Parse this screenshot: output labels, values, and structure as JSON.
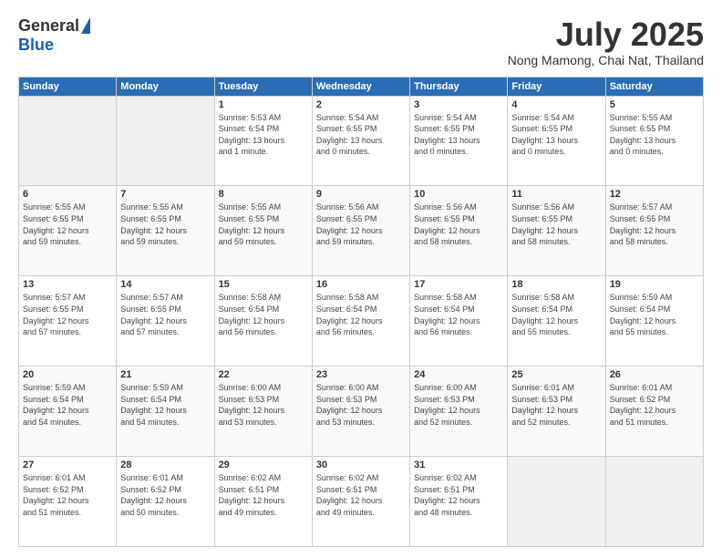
{
  "logo": {
    "general": "General",
    "blue": "Blue"
  },
  "header": {
    "title": "July 2025",
    "subtitle": "Nong Mamong, Chai Nat, Thailand"
  },
  "weekdays": [
    "Sunday",
    "Monday",
    "Tuesday",
    "Wednesday",
    "Thursday",
    "Friday",
    "Saturday"
  ],
  "weeks": [
    [
      {
        "day": "",
        "info": ""
      },
      {
        "day": "",
        "info": ""
      },
      {
        "day": "1",
        "info": "Sunrise: 5:53 AM\nSunset: 6:54 PM\nDaylight: 13 hours\nand 1 minute."
      },
      {
        "day": "2",
        "info": "Sunrise: 5:54 AM\nSunset: 6:55 PM\nDaylight: 13 hours\nand 0 minutes."
      },
      {
        "day": "3",
        "info": "Sunrise: 5:54 AM\nSunset: 6:55 PM\nDaylight: 13 hours\nand 0 minutes."
      },
      {
        "day": "4",
        "info": "Sunrise: 5:54 AM\nSunset: 6:55 PM\nDaylight: 13 hours\nand 0 minutes."
      },
      {
        "day": "5",
        "info": "Sunrise: 5:55 AM\nSunset: 6:55 PM\nDaylight: 13 hours\nand 0 minutes."
      }
    ],
    [
      {
        "day": "6",
        "info": "Sunrise: 5:55 AM\nSunset: 6:55 PM\nDaylight: 12 hours\nand 59 minutes."
      },
      {
        "day": "7",
        "info": "Sunrise: 5:55 AM\nSunset: 6:55 PM\nDaylight: 12 hours\nand 59 minutes."
      },
      {
        "day": "8",
        "info": "Sunrise: 5:55 AM\nSunset: 6:55 PM\nDaylight: 12 hours\nand 59 minutes."
      },
      {
        "day": "9",
        "info": "Sunrise: 5:56 AM\nSunset: 6:55 PM\nDaylight: 12 hours\nand 59 minutes."
      },
      {
        "day": "10",
        "info": "Sunrise: 5:56 AM\nSunset: 6:55 PM\nDaylight: 12 hours\nand 58 minutes."
      },
      {
        "day": "11",
        "info": "Sunrise: 5:56 AM\nSunset: 6:55 PM\nDaylight: 12 hours\nand 58 minutes."
      },
      {
        "day": "12",
        "info": "Sunrise: 5:57 AM\nSunset: 6:55 PM\nDaylight: 12 hours\nand 58 minutes."
      }
    ],
    [
      {
        "day": "13",
        "info": "Sunrise: 5:57 AM\nSunset: 6:55 PM\nDaylight: 12 hours\nand 57 minutes."
      },
      {
        "day": "14",
        "info": "Sunrise: 5:57 AM\nSunset: 6:55 PM\nDaylight: 12 hours\nand 57 minutes."
      },
      {
        "day": "15",
        "info": "Sunrise: 5:58 AM\nSunset: 6:54 PM\nDaylight: 12 hours\nand 56 minutes."
      },
      {
        "day": "16",
        "info": "Sunrise: 5:58 AM\nSunset: 6:54 PM\nDaylight: 12 hours\nand 56 minutes."
      },
      {
        "day": "17",
        "info": "Sunrise: 5:58 AM\nSunset: 6:54 PM\nDaylight: 12 hours\nand 56 minutes."
      },
      {
        "day": "18",
        "info": "Sunrise: 5:58 AM\nSunset: 6:54 PM\nDaylight: 12 hours\nand 55 minutes."
      },
      {
        "day": "19",
        "info": "Sunrise: 5:59 AM\nSunset: 6:54 PM\nDaylight: 12 hours\nand 55 minutes."
      }
    ],
    [
      {
        "day": "20",
        "info": "Sunrise: 5:59 AM\nSunset: 6:54 PM\nDaylight: 12 hours\nand 54 minutes."
      },
      {
        "day": "21",
        "info": "Sunrise: 5:59 AM\nSunset: 6:54 PM\nDaylight: 12 hours\nand 54 minutes."
      },
      {
        "day": "22",
        "info": "Sunrise: 6:00 AM\nSunset: 6:53 PM\nDaylight: 12 hours\nand 53 minutes."
      },
      {
        "day": "23",
        "info": "Sunrise: 6:00 AM\nSunset: 6:53 PM\nDaylight: 12 hours\nand 53 minutes."
      },
      {
        "day": "24",
        "info": "Sunrise: 6:00 AM\nSunset: 6:53 PM\nDaylight: 12 hours\nand 52 minutes."
      },
      {
        "day": "25",
        "info": "Sunrise: 6:01 AM\nSunset: 6:53 PM\nDaylight: 12 hours\nand 52 minutes."
      },
      {
        "day": "26",
        "info": "Sunrise: 6:01 AM\nSunset: 6:52 PM\nDaylight: 12 hours\nand 51 minutes."
      }
    ],
    [
      {
        "day": "27",
        "info": "Sunrise: 6:01 AM\nSunset: 6:52 PM\nDaylight: 12 hours\nand 51 minutes."
      },
      {
        "day": "28",
        "info": "Sunrise: 6:01 AM\nSunset: 6:52 PM\nDaylight: 12 hours\nand 50 minutes."
      },
      {
        "day": "29",
        "info": "Sunrise: 6:02 AM\nSunset: 6:51 PM\nDaylight: 12 hours\nand 49 minutes."
      },
      {
        "day": "30",
        "info": "Sunrise: 6:02 AM\nSunset: 6:51 PM\nDaylight: 12 hours\nand 49 minutes."
      },
      {
        "day": "31",
        "info": "Sunrise: 6:02 AM\nSunset: 6:51 PM\nDaylight: 12 hours\nand 48 minutes."
      },
      {
        "day": "",
        "info": ""
      },
      {
        "day": "",
        "info": ""
      }
    ]
  ]
}
